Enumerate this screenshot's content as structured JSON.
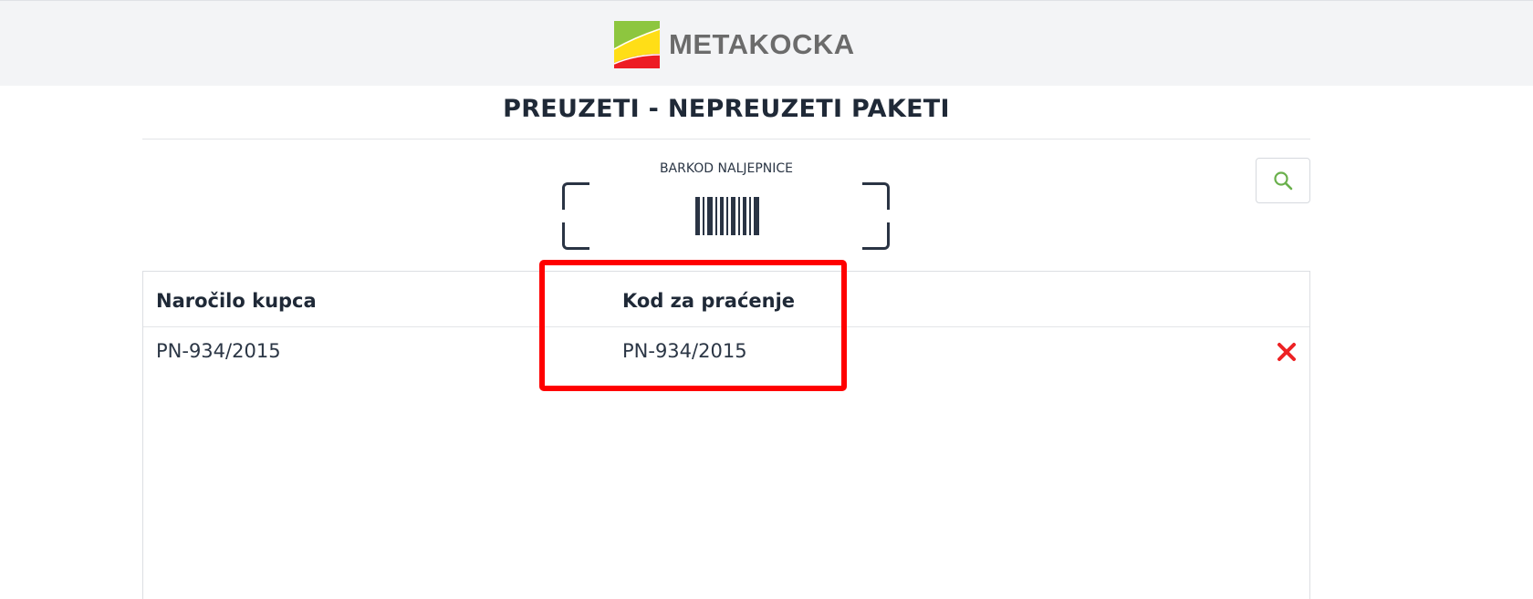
{
  "header": {
    "logo_text": "METAKOCKA",
    "logo_colors": [
      "#8dc63f",
      "#ffde17",
      "#ed1c24"
    ]
  },
  "page": {
    "title": "PREUZETI - NEPREUZETI PAKETI"
  },
  "scanner": {
    "label": "BARKOD NALJEPNICE",
    "icon": "barcode-icon"
  },
  "search": {
    "icon": "search-icon",
    "icon_color": "#6ab04c"
  },
  "table": {
    "columns": [
      "Naročilo kupca",
      "Kod za praćenje"
    ],
    "rows": [
      {
        "order": "PN-934/2015",
        "tracking": "PN-934/2015",
        "action_icon": "delete-x-icon"
      }
    ]
  },
  "annotation": {
    "color": "#ff0000"
  }
}
